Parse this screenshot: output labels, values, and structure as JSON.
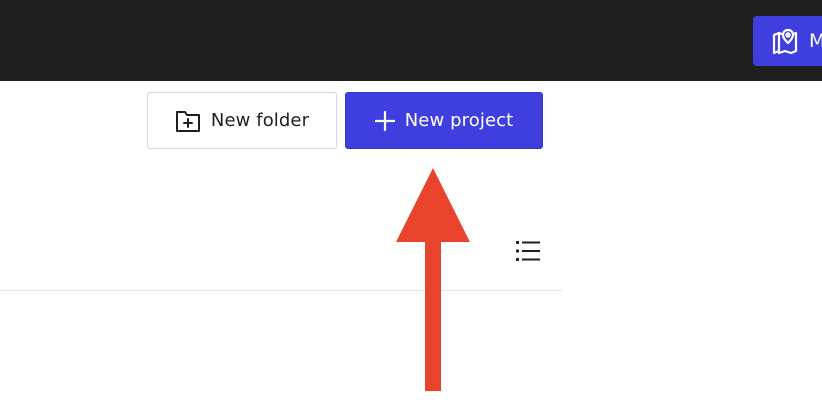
{
  "topbar": {
    "button_label": "M"
  },
  "toolbar": {
    "new_folder_label": "New folder",
    "new_project_label": "New project"
  },
  "colors": {
    "topbar_bg": "#1f1f1f",
    "primary": "#3f3fe0",
    "annotation_arrow": "#e8432b"
  },
  "icons": {
    "topbar_button": "map-pin-icon",
    "new_folder": "folder-plus-icon",
    "new_project": "plus-icon",
    "view_toggle": "list-view-icon"
  }
}
